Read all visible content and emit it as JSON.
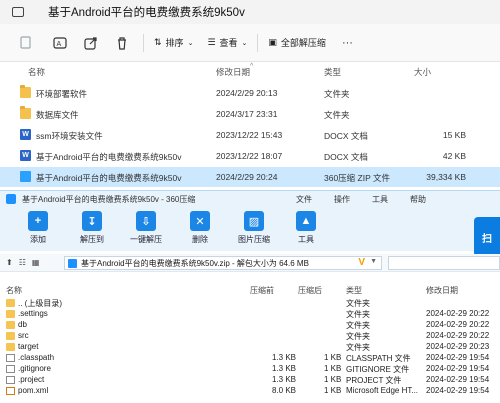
{
  "explorer": {
    "title": "基于Android平台的电费缴费系统9k50v",
    "toolbar": {
      "sort_label": "排序",
      "view_label": "查看",
      "select_all_label": "全部解压缩",
      "more_label": "···"
    },
    "columns": {
      "name": "名称",
      "date": "修改日期",
      "type": "类型",
      "size": "大小"
    },
    "rows": [
      {
        "icon": "folder-icon",
        "name": "环境部署软件",
        "date": "2024/2/29 20:13",
        "type": "文件夹",
        "size": ""
      },
      {
        "icon": "folder-icon",
        "name": "数据库文件",
        "date": "2024/3/17 23:31",
        "type": "文件夹",
        "size": ""
      },
      {
        "icon": "docx-icon",
        "name": "ssm环境安装文件",
        "date": "2023/12/22 15:43",
        "type": "DOCX 文档",
        "size": "15 KB"
      },
      {
        "icon": "docx-icon",
        "name": "基于Android平台的电费缴费系统9k50v",
        "date": "2023/12/22 18:07",
        "type": "DOCX 文档",
        "size": "42 KB"
      },
      {
        "icon": "zip-icon",
        "name": "基于Android平台的电费缴费系统9k50v",
        "date": "2024/2/29 20:24",
        "type": "360压缩 ZIP 文件",
        "size": "39,334 KB"
      }
    ]
  },
  "zip": {
    "title": "基于Android平台的电费缴费系统9k50v - 360压缩",
    "menu": [
      "文件",
      "操作",
      "工具",
      "帮助"
    ],
    "tools": [
      "添加",
      "解压到",
      "一键解压",
      "删除",
      "图片压缩",
      "工具"
    ],
    "brand": "扫",
    "path": "基于Android平台的电费缴费系统9k50v.zip - 解包大小为 64.6 MB",
    "columns": {
      "name": "名称",
      "compressed": "压缩前",
      "after": "压缩后",
      "type": "类型",
      "date": "修改日期"
    },
    "rows": [
      {
        "icon": "folder-icon",
        "name": ".. (上级目录)",
        "compressed": "",
        "after": "",
        "type": "文件夹",
        "date": ""
      },
      {
        "icon": "folder-icon",
        "name": ".settings",
        "compressed": "",
        "after": "",
        "type": "文件夹",
        "date": "2024-02-29 20:22"
      },
      {
        "icon": "folder-icon",
        "name": "db",
        "compressed": "",
        "after": "",
        "type": "文件夹",
        "date": "2024-02-29 20:22"
      },
      {
        "icon": "folder-icon",
        "name": "src",
        "compressed": "",
        "after": "",
        "type": "文件夹",
        "date": "2024-02-29 20:22"
      },
      {
        "icon": "folder-icon",
        "name": "target",
        "compressed": "",
        "after": "",
        "type": "文件夹",
        "date": "2024-02-29 20:23"
      },
      {
        "icon": "file-icon",
        "name": ".classpath",
        "compressed": "1.3 KB",
        "after": "1 KB",
        "type": "CLASSPATH 文件",
        "date": "2024-02-29 19:54"
      },
      {
        "icon": "file-icon",
        "name": ".gitignore",
        "compressed": "1.3 KB",
        "after": "1 KB",
        "type": "GITIGNORE 文件",
        "date": "2024-02-29 19:54"
      },
      {
        "icon": "file-icon",
        "name": ".project",
        "compressed": "1.3 KB",
        "after": "1 KB",
        "type": "PROJECT 文件",
        "date": "2024-02-29 19:54"
      },
      {
        "icon": "xml-icon",
        "name": "pom.xml",
        "compressed": "8.0 KB",
        "after": "1 KB",
        "type": "Microsoft Edge HT...",
        "date": "2024-02-29 19:54"
      }
    ]
  },
  "colors": {
    "selected_row": "#cce8ff",
    "zip_accent": "#1c86e6",
    "folder": "#f4c04e"
  }
}
